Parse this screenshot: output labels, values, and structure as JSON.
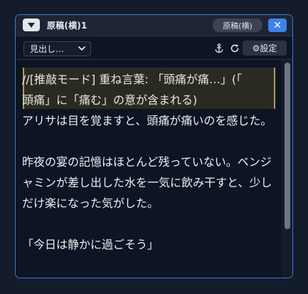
{
  "window": {
    "title": "原稿(横)1",
    "mode_badge": "原稿(横)",
    "close_glyph": "✕",
    "collapse_icon": "triangle-down-icon",
    "accent_color": "#3e82ec"
  },
  "toolbar": {
    "select_value": "見出し…",
    "select_chevron": "⌵",
    "anchor_glyph": "⚓",
    "refresh_glyph": "↻",
    "settings_label": "⚙設定"
  },
  "editor": {
    "note_line1": "//[推敲モード] 重ね言葉: 「頭痛が痛…」(「",
    "note_line2": "頭痛」に「痛む」の意が含まれる)",
    "paragraphs": [
      "アリサは目を覚ますと、頭痛が痛いのを感じた。",
      "",
      "昨夜の宴の記憶はほとんど残っていない。ベンジャミンが差し出した水を一気に飲み干すと、少しだけ楽になった気がした。",
      "",
      "「今日は静かに過ごそう」"
    ]
  }
}
